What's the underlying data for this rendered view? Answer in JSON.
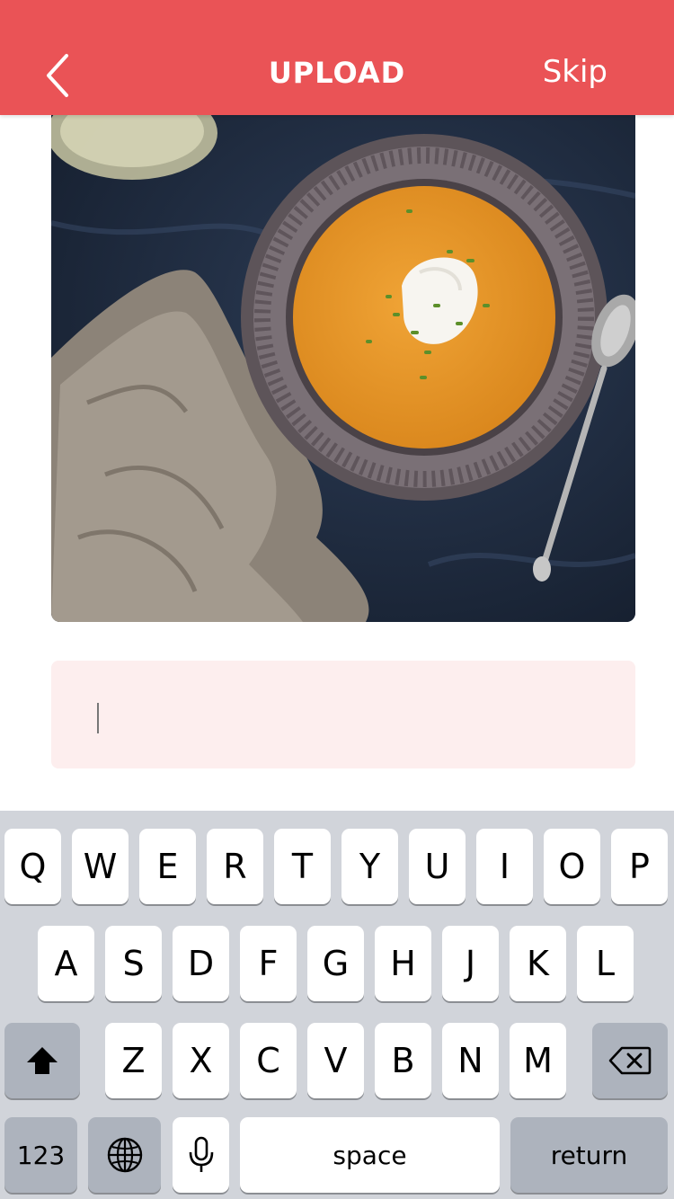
{
  "header": {
    "title": "UPLOAD",
    "skip_label": "Skip",
    "background": "#ea5356",
    "back_icon": "chevron-left-icon"
  },
  "photo": {
    "subject": "bowl of butternut squash soup with cream and chives"
  },
  "caption": {
    "value": "",
    "placeholder": "",
    "background": "#fdeeee"
  },
  "keyboard": {
    "row1": [
      "Q",
      "W",
      "E",
      "R",
      "T",
      "Y",
      "U",
      "I",
      "O",
      "P"
    ],
    "row2": [
      "A",
      "S",
      "D",
      "F",
      "G",
      "H",
      "J",
      "K",
      "L"
    ],
    "row3": [
      "Z",
      "X",
      "C",
      "V",
      "B",
      "N",
      "M"
    ],
    "numbers_label": "123",
    "space_label": "space",
    "return_label": "return",
    "shift_icon": "shift-icon",
    "delete_icon": "delete-icon",
    "globe_icon": "globe-icon",
    "mic_icon": "microphone-icon"
  }
}
